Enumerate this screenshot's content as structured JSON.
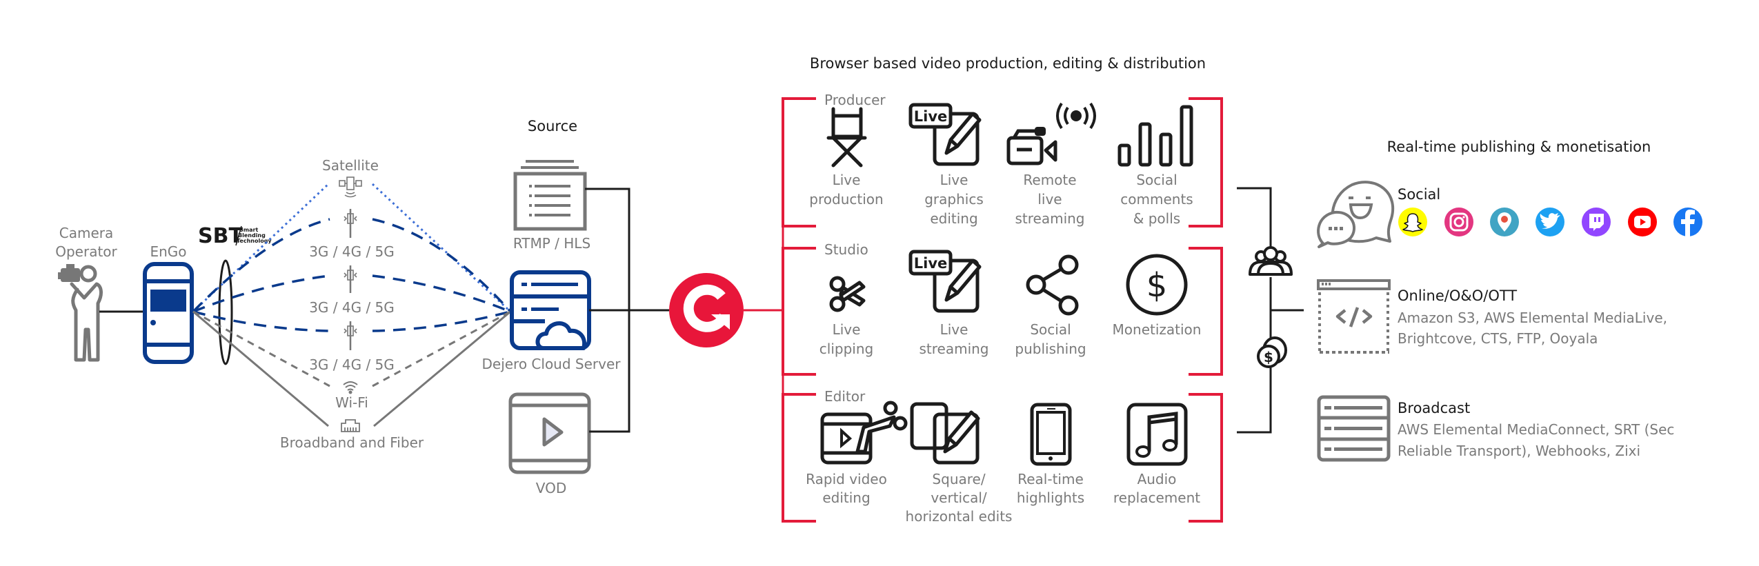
{
  "colors": {
    "brand_red": "#e8163a",
    "engo_blue": "#0a3a8c",
    "satellite_blue": "#3d6fd6",
    "icon_dark": "#1c1c1c",
    "icon_gray": "#777777",
    "label_gray": "#7a7a7a"
  },
  "capture": {
    "camera_operator": {
      "label_lines": [
        "Camera",
        "Operator"
      ],
      "icon": "camera-operator-icon"
    },
    "engo": {
      "label": "EnGo",
      "icon": "engo-device-icon"
    },
    "sbt": {
      "logo": "SBT",
      "tagline_lines": [
        "Smart",
        "Blending",
        "Technology"
      ]
    }
  },
  "networks": [
    {
      "label": "Satellite",
      "icon": "satellite-icon",
      "line_style": "dotted-blue"
    },
    {
      "label": "3G / 4G / 5G",
      "icon": "cell-tower-icon",
      "line_style": "dashed-navy"
    },
    {
      "label": "3G / 4G / 5G",
      "icon": "cell-tower-icon",
      "line_style": "dashed-navy"
    },
    {
      "label": "3G / 4G / 5G",
      "icon": "cell-tower-icon",
      "line_style": "dashed-navy"
    },
    {
      "label": "Wi-Fi",
      "icon": "wifi-icon",
      "line_style": "dashed-gray"
    },
    {
      "label": "Broadband and Fiber",
      "icon": "ethernet-port-icon",
      "line_style": "solid-gray"
    }
  ],
  "source": {
    "title": "Source",
    "items": [
      {
        "label": "RTMP / HLS",
        "icon": "stream-list-icon"
      },
      {
        "label": "Dejero Cloud Server",
        "icon": "cloud-server-icon"
      },
      {
        "label": "VOD",
        "icon": "video-player-icon"
      }
    ]
  },
  "hub": {
    "icon": "grabyo-logo-icon"
  },
  "production": {
    "title": "Browser based video production, editing & distribution",
    "groups": [
      {
        "name": "Producer",
        "items": [
          {
            "label_lines": [
              "Live",
              "production"
            ],
            "icon": "director-chair-icon"
          },
          {
            "label_lines": [
              "Live",
              "graphics",
              "editing"
            ],
            "icon": "live-graphics-edit-icon"
          },
          {
            "label_lines": [
              "Remote",
              "live",
              "streaming"
            ],
            "icon": "remote-camera-broadcast-icon"
          },
          {
            "label_lines": [
              "Social",
              "comments",
              "& polls"
            ],
            "icon": "bar-chart-icon"
          }
        ]
      },
      {
        "name": "Studio",
        "items": [
          {
            "label_lines": [
              "Live",
              "clipping"
            ],
            "icon": "scissors-icon"
          },
          {
            "label_lines": [
              "Live",
              "streaming"
            ],
            "icon": "live-edit-icon"
          },
          {
            "label_lines": [
              "Social",
              "publishing"
            ],
            "icon": "share-icon"
          },
          {
            "label_lines": [
              "Monetization"
            ],
            "icon": "dollar-coin-icon"
          }
        ]
      },
      {
        "name": "Editor",
        "items": [
          {
            "label_lines": [
              "Rapid video",
              "editing"
            ],
            "icon": "video-cut-icon"
          },
          {
            "label_lines": [
              "Square/",
              "vertical/",
              "horizontal edits"
            ],
            "icon": "aspect-ratio-edit-icon"
          },
          {
            "label_lines": [
              "Real-time",
              "highlights"
            ],
            "icon": "smartphone-icon"
          },
          {
            "label_lines": [
              "Audio",
              "replacement"
            ],
            "icon": "music-note-icon"
          }
        ]
      }
    ]
  },
  "distribution": {
    "title": "Real-time publishing & monetisation",
    "connector_icons": [
      "audience-icon",
      "coins-icon"
    ],
    "social": {
      "title": "Social",
      "icon": "chat-bubbles-icon",
      "platforms": [
        {
          "name": "Snapchat",
          "icon": "snapchat-icon",
          "color": "#fffc00"
        },
        {
          "name": "Instagram",
          "icon": "instagram-icon",
          "color": "#d6249f"
        },
        {
          "name": "Periscope",
          "icon": "periscope-icon",
          "color": "#40a4c4"
        },
        {
          "name": "Twitter",
          "icon": "twitter-icon",
          "color": "#1da1f2"
        },
        {
          "name": "Twitch",
          "icon": "twitch-icon",
          "color": "#9146ff"
        },
        {
          "name": "YouTube",
          "icon": "youtube-icon",
          "color": "#ff0000"
        },
        {
          "name": "Facebook",
          "icon": "facebook-icon",
          "color": "#1877f2"
        }
      ]
    },
    "online": {
      "title": "Online/O&O/OTT",
      "icon": "code-window-icon",
      "desc_lines": [
        "Amazon S3, AWS Elemental MediaLive,",
        "Brightcove, CTS, FTP, Ooyala"
      ]
    },
    "broadcast": {
      "title": "Broadcast",
      "icon": "server-rack-icon",
      "desc_lines": [
        "AWS Elemental MediaConnect, SRT (Sec",
        "Reliable Transport), Webhooks, Zixi"
      ]
    }
  }
}
